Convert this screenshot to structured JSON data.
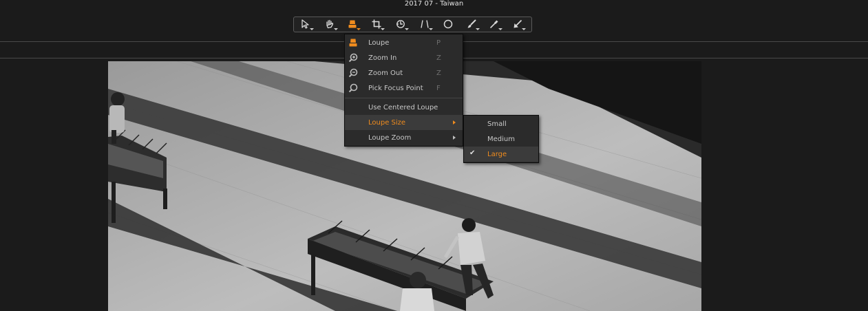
{
  "window": {
    "title": "2017 07 - Taiwan"
  },
  "toolbar": {
    "tools": [
      {
        "icon": "select-arrow-icon",
        "active": false
      },
      {
        "icon": "hand-pan-icon",
        "active": false
      },
      {
        "icon": "loupe-icon",
        "active": true
      },
      {
        "icon": "crop-icon",
        "active": false
      },
      {
        "icon": "straighten-rotate-icon",
        "active": false
      },
      {
        "icon": "perspective-keystone-icon",
        "active": false
      },
      {
        "icon": "circle-mask-icon",
        "active": false
      },
      {
        "icon": "brush-icon",
        "active": false
      },
      {
        "icon": "eyedropper-icon",
        "active": false
      },
      {
        "icon": "annotate-arrow-icon",
        "active": false
      }
    ]
  },
  "loupe_menu": {
    "items": [
      {
        "label": "Loupe",
        "shortcut": "P",
        "icon": "loupe-icon"
      },
      {
        "label": "Zoom In",
        "shortcut": "Z",
        "icon": "zoom-in-icon"
      },
      {
        "label": "Zoom Out",
        "shortcut": "Z",
        "icon": "zoom-out-icon"
      },
      {
        "label": "Pick Focus Point",
        "shortcut": "F",
        "icon": "focus-point-icon"
      },
      {
        "label": "Use Centered Loupe"
      },
      {
        "label": "Loupe Size",
        "submenu": true,
        "highlighted": true
      },
      {
        "label": "Loupe Zoom",
        "submenu": true
      }
    ]
  },
  "loupe_size_menu": {
    "items": [
      {
        "label": "Small",
        "checked": false
      },
      {
        "label": "Medium",
        "checked": false
      },
      {
        "label": "Large",
        "checked": true
      }
    ]
  },
  "colors": {
    "accent": "#f08c1e",
    "background": "#1b1b1b",
    "menu": "#2b2b2b"
  }
}
